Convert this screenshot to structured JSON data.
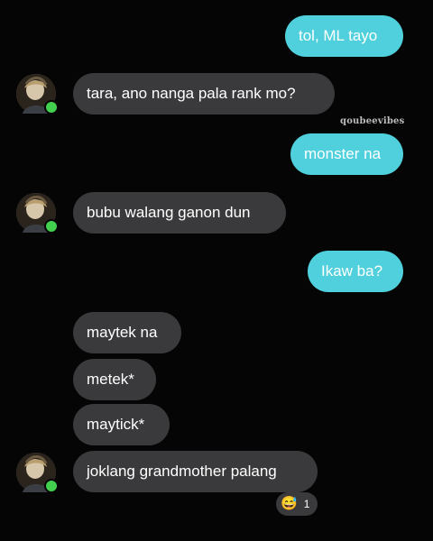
{
  "messages": [
    {
      "text": "tol, ML tayo",
      "direction": "outgoing"
    },
    {
      "text": "tara, ano nanga pala rank mo?",
      "direction": "incoming"
    },
    {
      "text": "monster na",
      "direction": "outgoing"
    },
    {
      "text": "bubu walang ganon dun",
      "direction": "incoming"
    },
    {
      "text": "Ikaw ba?",
      "direction": "outgoing"
    },
    {
      "text": "maytek na",
      "direction": "incoming"
    },
    {
      "text": "metek*",
      "direction": "incoming"
    },
    {
      "text": "maytick*",
      "direction": "incoming"
    },
    {
      "text": "joklang grandmother palang",
      "direction": "incoming"
    }
  ],
  "watermark": "qoubeevibes",
  "reaction": {
    "emoji": "😅",
    "count": "1"
  },
  "colors": {
    "background": "#050505",
    "outgoing_bubble": "#4fd0dc",
    "incoming_bubble": "#3a3a3c",
    "online_indicator": "#44d04f"
  },
  "icons": {
    "avatar": "profile-avatar",
    "online": "online-status-dot",
    "reaction": "grinning-sweat-emoji"
  }
}
